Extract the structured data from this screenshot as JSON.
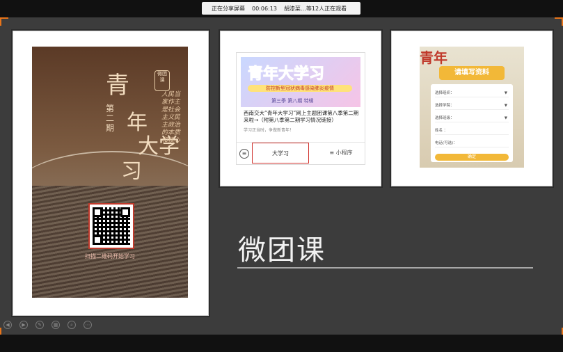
{
  "share_bar": {
    "status": "正在分享屏幕",
    "timer": "00:06:13",
    "viewers": "胡漆菜…等12人正在观看"
  },
  "poster": {
    "title_lines": [
      "青",
      "年",
      "大学",
      "习"
    ],
    "issue": "第二期",
    "seal": "微团课",
    "slogan": "人民当家作主是社会主义民主政治的本质和核心",
    "scan_text": "扫描二维码开始学习"
  },
  "article_card": {
    "banner_title": "青年大学习",
    "banner_subtitle": "防控新型冠状病毒感染肺炎疫情",
    "banner_footer": "第三季 第八期 特辑",
    "description": "西南交大“青年大学习”网上主题团课第八季第二期来啦→（附第八季第二期学习情况链接）",
    "tip": "学习正当时，争做新青年！",
    "tab_primary": "大学习",
    "tab_secondary": "≡ 小程序",
    "menu_glyph": "≡"
  },
  "form_shot": {
    "bg_text": "青年",
    "header": "请填写资料",
    "rows": [
      {
        "label": "选择组织：",
        "arrow": "▼"
      },
      {
        "label": "选择学院：",
        "arrow": "▼"
      },
      {
        "label": "选择班级：",
        "arrow": "▼"
      },
      {
        "label": "姓名  ：",
        "arrow": ""
      },
      {
        "label": "电话(可选)：",
        "arrow": ""
      }
    ],
    "submit": "确定"
  },
  "slide": {
    "section_title": "微团课"
  },
  "controls": [
    {
      "name": "prev-icon",
      "glyph": "◀"
    },
    {
      "name": "next-icon",
      "glyph": "▶"
    },
    {
      "name": "pen-icon",
      "glyph": "✎"
    },
    {
      "name": "slides-icon",
      "glyph": "▦"
    },
    {
      "name": "zoom-icon",
      "glyph": "⌕"
    },
    {
      "name": "more-icon",
      "glyph": "⋯"
    }
  ],
  "colors": {
    "accent": "#e8741a",
    "stage_bg": "#3c3c3c",
    "highlight_red": "#d0302b"
  }
}
